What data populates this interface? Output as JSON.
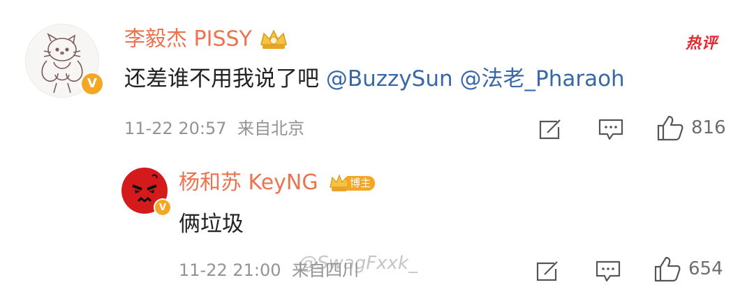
{
  "top_comment": {
    "username": "李毅杰 PISSY",
    "hot_label": "热评",
    "text_plain": "还差谁不用我说了吧 ",
    "mention_1": "@BuzzySun",
    "mention_2": "@法老_Pharaoh",
    "timestamp": "11-22 20:57",
    "location": "来自北京",
    "like_count": "816",
    "verified_badge": "V",
    "icons": [
      "edit-icon",
      "comment-icon",
      "like-icon"
    ]
  },
  "reply": {
    "username": "杨和苏 KeyNG",
    "role_badge": "博主",
    "text": "俩垃圾",
    "timestamp": "11-22 21:00",
    "location": "来自四川",
    "like_count": "654",
    "verified_badge": "V",
    "icons": [
      "edit-icon",
      "comment-icon",
      "like-icon"
    ]
  },
  "watermark": "@SwagFxxk_",
  "colors": {
    "username": "#eb7350",
    "mention": "#3868a6",
    "hot": "#e8262e",
    "badge": "#f5a623",
    "meta": "#939393"
  }
}
